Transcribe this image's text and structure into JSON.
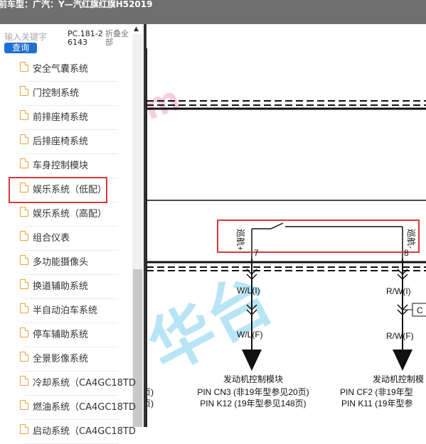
{
  "title_bar": "前车型：广汽：Y—汽红旗红旗H52019",
  "sidebar": {
    "search_placeholder": "输入关键字",
    "query_label": "查询",
    "pc_code": "PC.181-26143",
    "collapse_label": "折叠全部",
    "items": [
      {
        "label": "安全气囊系统"
      },
      {
        "label": "门控制系统"
      },
      {
        "label": "前排座椅系统"
      },
      {
        "label": "后排座椅系统"
      },
      {
        "label": "车身控制模块"
      },
      {
        "label": "娱乐系统（低配）"
      },
      {
        "label": "娱乐系统（高配）"
      },
      {
        "label": "组合仪表"
      },
      {
        "label": "多功能摄像头"
      },
      {
        "label": "换道辅助系统"
      },
      {
        "label": "半自动泊车系统"
      },
      {
        "label": "停车辅助系统"
      },
      {
        "label": "全景影像系统"
      },
      {
        "label": "冷却系统（CA4GC18TD"
      },
      {
        "label": "燃油系统（CA4GC18TD"
      },
      {
        "label": "启动系统（CA4GC18TD"
      }
    ]
  },
  "diagram": {
    "switch_left_label": "巡航+",
    "switch_right_label": "巡航-",
    "pin_left_num": "7",
    "pin_right_num": "8",
    "wire_left_top": "W/L(I)",
    "wire_left_bottom": "W/L(F)",
    "wire_right_top": "R/W(I)",
    "wire_right_bottom": "R/W(F)",
    "connector_tag": "C",
    "ecm_left_title": "发动机控制模块",
    "ecm_left_pin1": "PIN CN3 (非19年型参见20页)",
    "ecm_left_pin2": "PIN K12 (19年型参见148页)",
    "ecm_right_title": "发动机控制模",
    "ecm_right_pin1": "PIN CF2 (非19年型",
    "ecm_right_pin2": "PIN K11 (19年型参",
    "left_edge_1": "页)",
    "left_edge_2": "页)"
  }
}
